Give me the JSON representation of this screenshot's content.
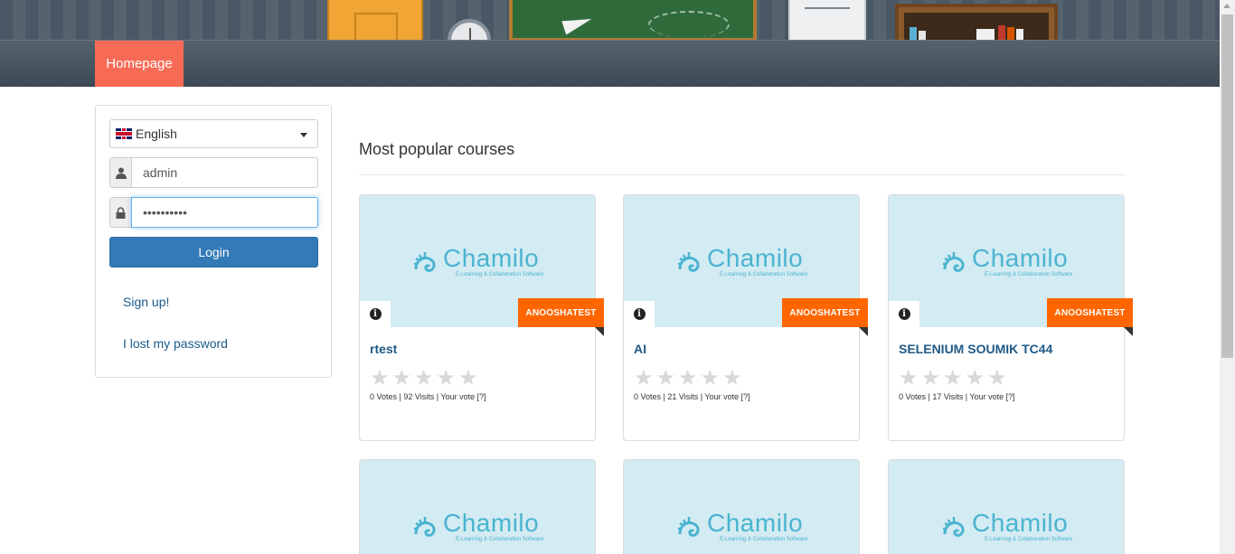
{
  "nav": {
    "home_label": "Homepage"
  },
  "login": {
    "language": "English",
    "username": "admin",
    "password_mask": "••••••••••",
    "login_label": "Login",
    "signup_label": "Sign up!",
    "lost_password_label": "I lost my password"
  },
  "main": {
    "section_title": "Most popular courses",
    "logo_text": "Chamilo",
    "logo_sub": "E-Learning & Collaboration Software",
    "courses": [
      {
        "title": "rtest",
        "badge": "ANOOSHATEST",
        "stats": "0 Votes | 92 Visits | Your vote [?]"
      },
      {
        "title": "AI",
        "badge": "ANOOSHATEST",
        "stats": "0 Votes | 21 Visits | Your vote [?]"
      },
      {
        "title": "SELENIUM SOUMIK TC44",
        "badge": "ANOOSHATEST",
        "stats": "0 Votes | 17 Visits | Your vote [?]"
      }
    ]
  },
  "colors": {
    "accent": "#f76b56",
    "primary": "#337ab7",
    "badge": "#ff6600",
    "card_image": "#d3ebf2"
  }
}
